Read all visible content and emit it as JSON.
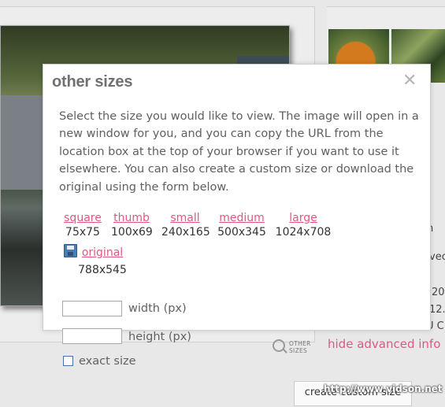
{
  "background": {
    "side_text_fragments": [
      "n",
      "vec",
      "20",
      "12.",
      "U C"
    ],
    "hide_advanced_label": "hide advanced info",
    "other_sizes_button": {
      "line1": "OTHER",
      "line2": "SIZES"
    },
    "create_custom_label": "create custom size",
    "watermark": "http://www.vidson.net"
  },
  "dialog": {
    "title": "other sizes",
    "close_symbol": "✕",
    "description": "Select the size you would like to view. The image will open in a new window for you, and you can copy the URL from the location box at the top of your browser if you want to use it elsewhere. You can also create a custom size or download the original using the form below.",
    "sizes": [
      {
        "label": "square",
        "dims": "75x75"
      },
      {
        "label": "thumb",
        "dims": "100x69"
      },
      {
        "label": "small",
        "dims": "240x165"
      },
      {
        "label": "medium",
        "dims": "500x345"
      },
      {
        "label": "large",
        "dims": "1024x708"
      }
    ],
    "original": {
      "label": "original",
      "dims": "788x545"
    },
    "form": {
      "width_label": "width (px)",
      "width_value": "",
      "height_label": "height (px)",
      "height_value": "",
      "exact_label": "exact size"
    }
  },
  "colors": {
    "link": "#e0587f",
    "title": "#707070",
    "text": "#606060"
  }
}
